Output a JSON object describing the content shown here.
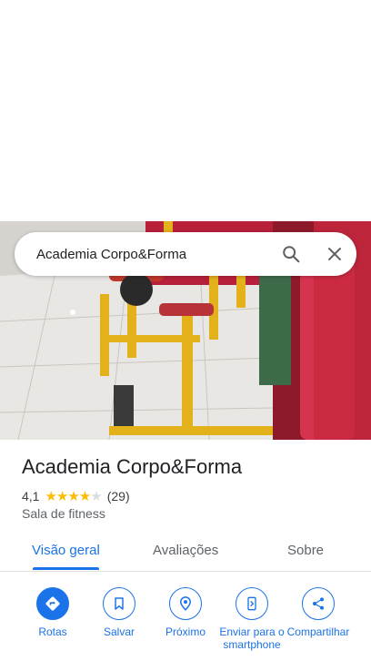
{
  "search": {
    "query": "Academia Corpo&Forma"
  },
  "place": {
    "name": "Academia Corpo&Forma",
    "rating": "4,1",
    "rating_value": 4.1,
    "review_count": "(29)",
    "category": "Sala de fitness"
  },
  "tabs": [
    {
      "label": "Visão geral",
      "active": true
    },
    {
      "label": "Avaliações",
      "active": false
    },
    {
      "label": "Sobre",
      "active": false
    }
  ],
  "actions": [
    {
      "label": "Rotas",
      "icon": "directions-icon"
    },
    {
      "label": "Salvar",
      "icon": "bookmark-icon"
    },
    {
      "label": "Próximo",
      "icon": "nearby-icon"
    },
    {
      "label": "Enviar para o smartphone",
      "icon": "send-to-phone-icon"
    },
    {
      "label": "Compartilhar",
      "icon": "share-icon"
    }
  ],
  "colors": {
    "accent": "#1a73e8",
    "star": "#fbbc04"
  }
}
